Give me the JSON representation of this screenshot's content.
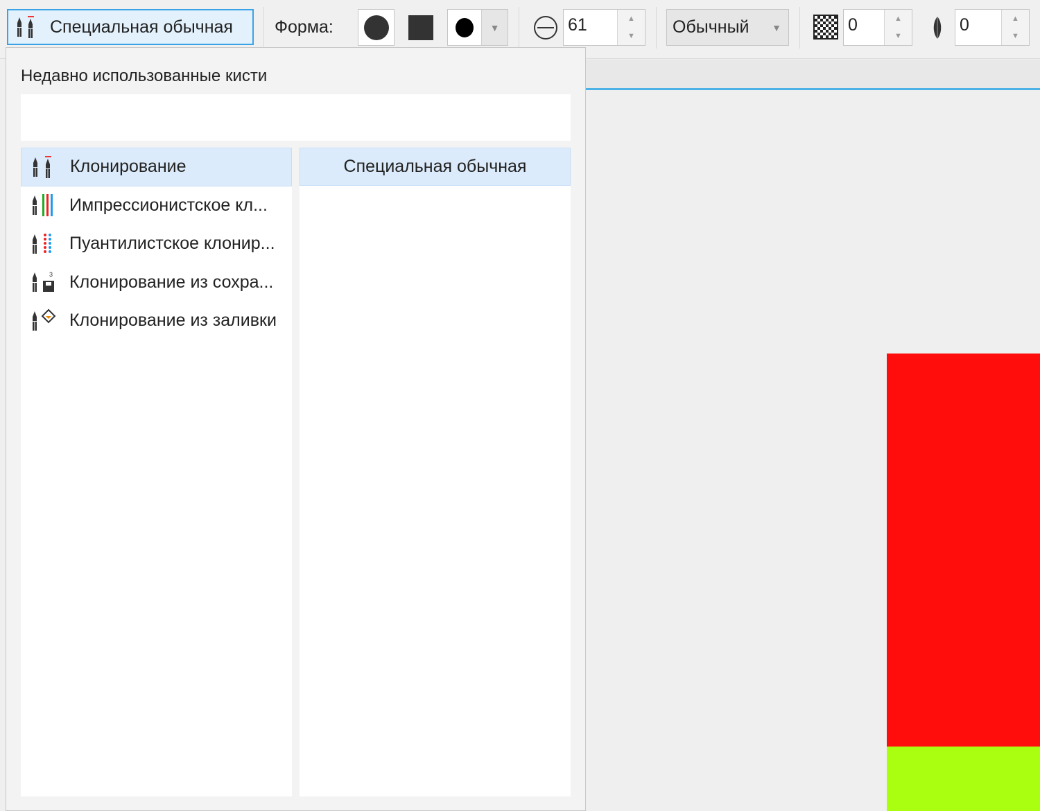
{
  "toolbar": {
    "brush_label": "Специальная обычная",
    "shape_label": "Форма:",
    "size_value": "61",
    "blend_mode": "Обычный",
    "transparency_value": "0",
    "feather_value": "0"
  },
  "popup": {
    "title": "Недавно использованные кисти",
    "categories": [
      {
        "label": "Клонирование",
        "icon": "clone-icon",
        "selected": true
      },
      {
        "label": "Импрессионистское кл...",
        "icon": "impressionist-clone-icon"
      },
      {
        "label": "Пуантилистское клонир...",
        "icon": "pointillist-clone-icon"
      },
      {
        "label": "Клонирование из сохра...",
        "icon": "clone-from-saved-icon"
      },
      {
        "label": "Клонирование из заливки",
        "icon": "clone-from-fill-icon"
      }
    ],
    "brushes": [
      {
        "label": "Специальная обычная",
        "selected": true
      }
    ]
  },
  "canvas": {
    "colors": [
      "#ff0d0d",
      "#aaff11"
    ]
  }
}
